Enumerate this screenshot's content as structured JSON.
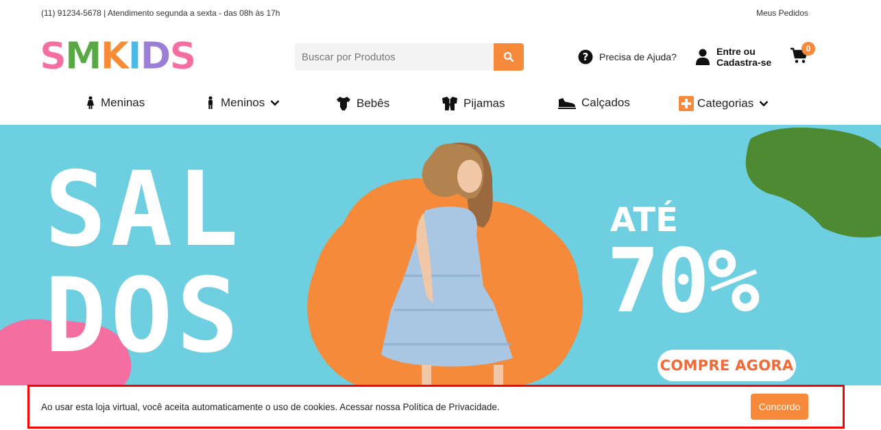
{
  "topbar": {
    "contact": "(11) 91234-5678 | Atendimento segunda a sexta - das 08h às 17h",
    "orders_link": "Meus Pedidos"
  },
  "logo": {
    "letters": [
      "S",
      "M",
      "K",
      "I",
      "D",
      "S"
    ],
    "colors": [
      "#f36fa0",
      "#58a845",
      "#f58b35",
      "#4fb7e4",
      "#9a7fd4",
      "#f36fa0"
    ]
  },
  "search": {
    "placeholder": "Buscar por Produtos",
    "icon": "search-icon"
  },
  "help": {
    "label": "Precisa de Ajuda?",
    "icon": "question-circle-icon"
  },
  "account": {
    "line1": "Entre ou",
    "line2": "Cadastra-se",
    "icon": "user-icon"
  },
  "cart": {
    "count": "0",
    "icon": "cart-icon"
  },
  "nav": {
    "items": [
      {
        "label": "Meninas",
        "icon": "girl-icon",
        "dropdown": false
      },
      {
        "label": "Meninos",
        "icon": "boy-icon",
        "dropdown": true
      },
      {
        "label": "Bebês",
        "icon": "bodysuit-icon",
        "dropdown": false
      },
      {
        "label": "Pijamas",
        "icon": "pajamas-icon",
        "dropdown": false
      },
      {
        "label": "Calçados",
        "icon": "shoe-icon",
        "dropdown": false
      },
      {
        "label": "Categorias",
        "icon": "plus-square-icon",
        "dropdown": true
      }
    ]
  },
  "banner": {
    "line1": "SAL",
    "line2": "DOS",
    "discount_prefix": "ATÉ",
    "discount_value": "70%",
    "cta": "COMPRE AGORA"
  },
  "cookie": {
    "text": "Ao usar esta loja virtual, você aceita automaticamente o uso de cookies. Acessar nossa Política de Privacidade.",
    "accept": "Concordo"
  },
  "colors": {
    "accent": "#f68a3a",
    "banner_bg": "#6dcfe0",
    "cta_text": "#f26a35",
    "highlight_border": "#ff0000"
  }
}
